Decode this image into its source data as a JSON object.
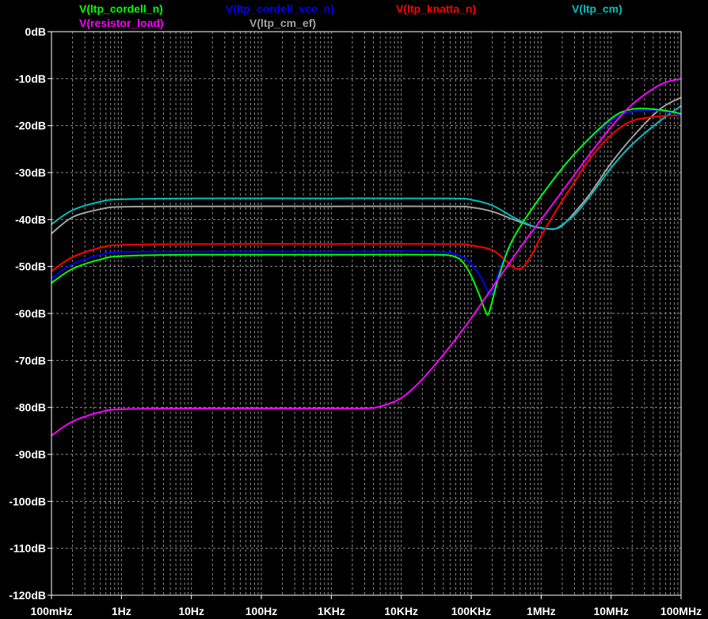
{
  "chart_data": {
    "type": "line",
    "x_scale": "log",
    "x_range": [
      0.1,
      100000000
    ],
    "ylim": [
      -120,
      0
    ],
    "grid": true,
    "background": "#000000",
    "frame_color": "#ffffff",
    "grid_color": "#8c8c8c",
    "x_ticks": [
      {
        "value": 0.1,
        "label": "100mHz"
      },
      {
        "value": 1,
        "label": "1Hz"
      },
      {
        "value": 10,
        "label": "10Hz"
      },
      {
        "value": 100,
        "label": "100Hz"
      },
      {
        "value": 1000,
        "label": "1KHz"
      },
      {
        "value": 10000,
        "label": "10KHz"
      },
      {
        "value": 100000,
        "label": "100KHz"
      },
      {
        "value": 1000000,
        "label": "1MHz"
      },
      {
        "value": 10000000,
        "label": "10MHz"
      },
      {
        "value": 100000000,
        "label": "100MHz"
      }
    ],
    "y_ticks": [
      {
        "value": 0,
        "label": "0dB"
      },
      {
        "value": -10,
        "label": "-10dB"
      },
      {
        "value": -20,
        "label": "-20dB"
      },
      {
        "value": -30,
        "label": "-30dB"
      },
      {
        "value": -40,
        "label": "-40dB"
      },
      {
        "value": -50,
        "label": "-50dB"
      },
      {
        "value": -60,
        "label": "-60dB"
      },
      {
        "value": -70,
        "label": "-70dB"
      },
      {
        "value": -80,
        "label": "-80dB"
      },
      {
        "value": -90,
        "label": "-90dB"
      },
      {
        "value": -100,
        "label": "-100dB"
      },
      {
        "value": -110,
        "label": "-110dB"
      },
      {
        "value": -120,
        "label": "-120dB"
      }
    ],
    "legend_rows": [
      [
        "ltp_cordell_n",
        "ltp_cordell_vce_n",
        "ltp_knatta_n",
        "ltp_cm"
      ],
      [
        "resistor_load",
        "ltp_cm_ef"
      ]
    ],
    "series": [
      {
        "id": "ltp_cordell_n",
        "name": "V(ltp_cordell_n)",
        "color": "#00ff00",
        "points": [
          [
            0.1,
            -53.5
          ],
          [
            0.2,
            -50.5
          ],
          [
            0.5,
            -48.5
          ],
          [
            1,
            -47.8
          ],
          [
            10,
            -47.5
          ],
          [
            1000,
            -47.5
          ],
          [
            30000,
            -47.5
          ],
          [
            60000,
            -48
          ],
          [
            80000,
            -49.5
          ],
          [
            100000,
            -52
          ],
          [
            130000,
            -56
          ],
          [
            160000,
            -59.5
          ],
          [
            175000,
            -60.2
          ],
          [
            195000,
            -58
          ],
          [
            250000,
            -52
          ],
          [
            400000,
            -44
          ],
          [
            1000000,
            -35
          ],
          [
            3000000,
            -26
          ],
          [
            10000000,
            -18.5
          ],
          [
            20000000,
            -16.5
          ],
          [
            40000000,
            -16.5
          ],
          [
            70000000,
            -17
          ],
          [
            100000000,
            -17.5
          ]
        ]
      },
      {
        "id": "ltp_cordell_vce_n",
        "name": "V(ltp_cordell_vce_n)",
        "color": "#0000ff",
        "points": [
          [
            0.1,
            -52.5
          ],
          [
            0.2,
            -49.5
          ],
          [
            0.5,
            -47.5
          ],
          [
            1,
            -46.9
          ],
          [
            10,
            -46.8
          ],
          [
            1000,
            -46.8
          ],
          [
            30000,
            -46.8
          ],
          [
            70000,
            -47.8
          ],
          [
            100000,
            -49.5
          ],
          [
            140000,
            -52.5
          ],
          [
            180000,
            -55.8
          ],
          [
            200000,
            -55.3
          ],
          [
            250000,
            -51
          ],
          [
            400000,
            -44
          ],
          [
            1000000,
            -35
          ],
          [
            3000000,
            -26
          ],
          [
            10000000,
            -19
          ],
          [
            20000000,
            -17
          ],
          [
            40000000,
            -16.7
          ],
          [
            70000000,
            -17.2
          ],
          [
            100000000,
            -17.8
          ]
        ]
      },
      {
        "id": "ltp_knatta_n",
        "name": "V(ltp_knatta_n)",
        "color": "#ff0000",
        "points": [
          [
            0.1,
            -51
          ],
          [
            0.2,
            -48
          ],
          [
            0.5,
            -46
          ],
          [
            1,
            -45.4
          ],
          [
            10,
            -45.2
          ],
          [
            1000,
            -45.2
          ],
          [
            50000,
            -45.2
          ],
          [
            100000,
            -45.5
          ],
          [
            200000,
            -46.5
          ],
          [
            300000,
            -48.5
          ],
          [
            400000,
            -50.2
          ],
          [
            500000,
            -50.5
          ],
          [
            600000,
            -49.5
          ],
          [
            800000,
            -46.5
          ],
          [
            1000000,
            -43.5
          ],
          [
            2000000,
            -36
          ],
          [
            3000000,
            -32
          ],
          [
            5000000,
            -27
          ],
          [
            10000000,
            -22
          ],
          [
            20000000,
            -19
          ],
          [
            50000000,
            -18
          ],
          [
            100000000,
            -17.8
          ]
        ]
      },
      {
        "id": "ltp_cm",
        "name": "V(ltp_cm)",
        "color": "#00c0c0",
        "points": [
          [
            0.1,
            -41
          ],
          [
            0.2,
            -38
          ],
          [
            0.5,
            -36.2
          ],
          [
            1,
            -35.7
          ],
          [
            10,
            -35.5
          ],
          [
            1000,
            -35.5
          ],
          [
            50000,
            -35.5
          ],
          [
            100000,
            -35.8
          ],
          [
            200000,
            -37
          ],
          [
            400000,
            -39.5
          ],
          [
            700000,
            -41.2
          ],
          [
            1000000,
            -41.8
          ],
          [
            1300000,
            -42
          ],
          [
            1700000,
            -41.8
          ],
          [
            3000000,
            -39
          ],
          [
            5000000,
            -35
          ],
          [
            10000000,
            -29
          ],
          [
            20000000,
            -24
          ],
          [
            50000000,
            -19
          ],
          [
            100000000,
            -15.8
          ]
        ]
      },
      {
        "id": "resistor_load",
        "name": "V(resistor_load)",
        "color": "#ff00ff",
        "points": [
          [
            0.1,
            -86
          ],
          [
            0.2,
            -83
          ],
          [
            0.5,
            -81
          ],
          [
            1,
            -80.4
          ],
          [
            10,
            -80.2
          ],
          [
            1000,
            -80.2
          ],
          [
            3000,
            -80.2
          ],
          [
            5000,
            -79.8
          ],
          [
            10000,
            -78
          ],
          [
            20000,
            -74
          ],
          [
            50000,
            -67
          ],
          [
            100000,
            -61
          ],
          [
            200000,
            -54.5
          ],
          [
            500000,
            -46
          ],
          [
            1000000,
            -40
          ],
          [
            2000000,
            -34
          ],
          [
            5000000,
            -26
          ],
          [
            10000000,
            -20.3
          ],
          [
            20000000,
            -15.5
          ],
          [
            50000000,
            -11.3
          ],
          [
            100000000,
            -10
          ]
        ]
      },
      {
        "id": "ltp_cm_ef",
        "name": "V(ltp_cm_ef)",
        "color": "#a0a0a0",
        "points": [
          [
            0.1,
            -43
          ],
          [
            0.2,
            -39.5
          ],
          [
            0.5,
            -37.8
          ],
          [
            1,
            -37.3
          ],
          [
            10,
            -37.2
          ],
          [
            1000,
            -37.2
          ],
          [
            50000,
            -37.2
          ],
          [
            100000,
            -37.4
          ],
          [
            200000,
            -38.3
          ],
          [
            400000,
            -40
          ],
          [
            700000,
            -41.3
          ],
          [
            1000000,
            -41.8
          ],
          [
            1500000,
            -42
          ],
          [
            2000000,
            -41.3
          ],
          [
            3000000,
            -38.5
          ],
          [
            5000000,
            -34.5
          ],
          [
            10000000,
            -28
          ],
          [
            20000000,
            -22.5
          ],
          [
            50000000,
            -16.5
          ],
          [
            100000000,
            -14
          ]
        ]
      }
    ]
  }
}
